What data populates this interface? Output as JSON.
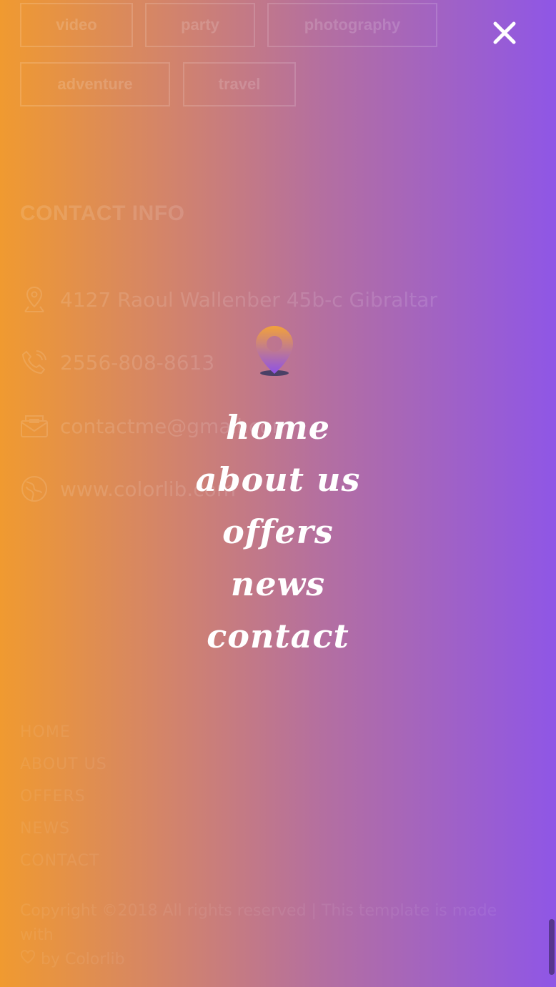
{
  "tags": {
    "row1": [
      "video",
      "party",
      "photography"
    ],
    "row2": [
      "adventure",
      "travel"
    ]
  },
  "contact": {
    "title": "CONTACT INFO",
    "items": [
      {
        "icon": "map-pin-icon",
        "text": "4127 Raoul Wallenber 45b-c Gibraltar"
      },
      {
        "icon": "phone-icon",
        "text": "2556-808-8613"
      },
      {
        "icon": "mail-icon",
        "text": "contactme@gmail.com"
      },
      {
        "icon": "globe-icon",
        "text": "www.colorlib.com"
      }
    ]
  },
  "footer": {
    "links": [
      "HOME",
      "ABOUT US",
      "OFFERS",
      "NEWS",
      "CONTACT"
    ],
    "copyright_line1": "Copyright ©2018 All rights reserved | This template is made with",
    "copyright_line2": "by Colorlib"
  },
  "overlay": {
    "close_icon": "close-icon",
    "logo_icon": "location-pin-logo-icon",
    "menu": [
      "home",
      "about us",
      "offers",
      "news",
      "contact"
    ]
  },
  "colors": {
    "gradient_left": "#f09a30",
    "gradient_right": "#8f56e6",
    "text": "#ffffff"
  }
}
